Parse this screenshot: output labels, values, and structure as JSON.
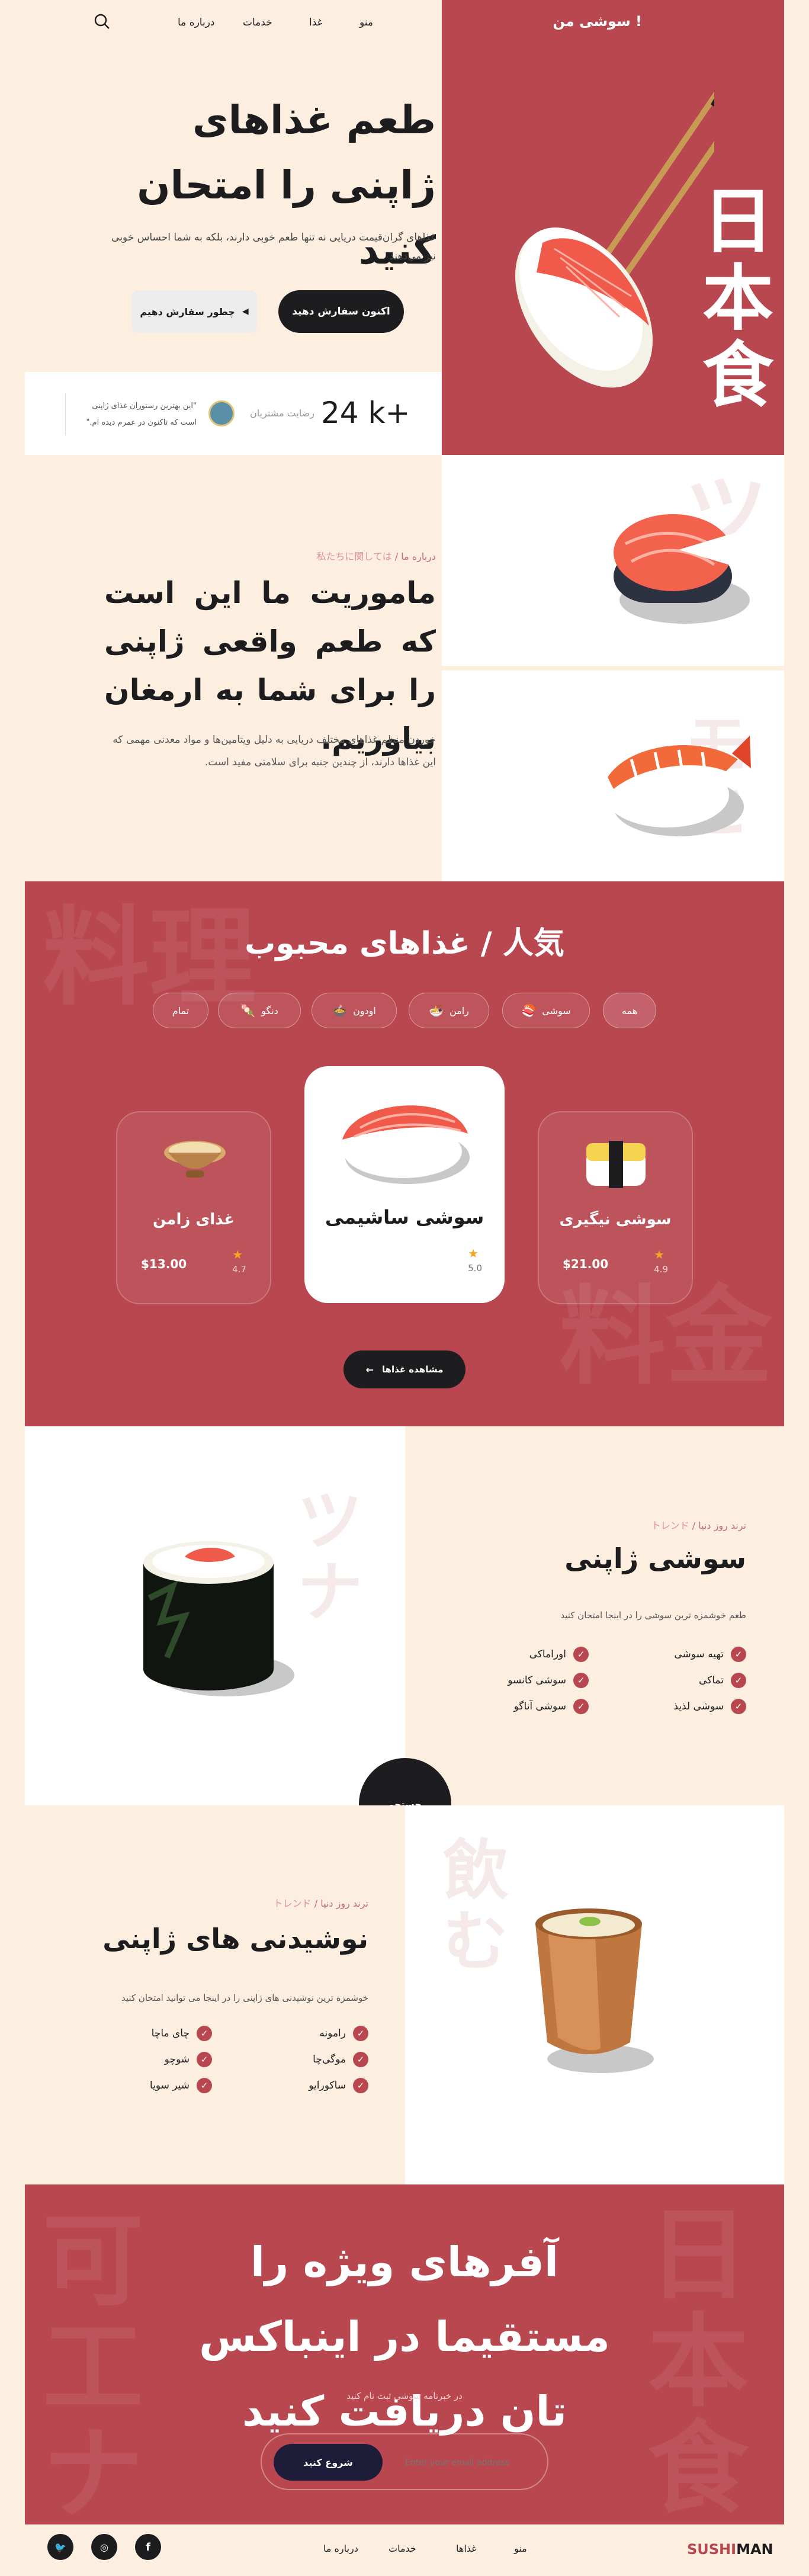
{
  "nav": {
    "menu": "منو",
    "foods": "غذا",
    "services": "خدمات",
    "about": "درباره ما",
    "brand": "سوشی من !"
  },
  "hero": {
    "title": "طعم غذاهای ژاپنی را امتحان کنید",
    "subtitle": "غذاهای گران‌قیمت دریایی نه تنها طعم خوبی دارند، بلکه به شما احساس خوبی نیز می‌دهند",
    "order_label": "اکنون سفارش دهید",
    "how_label": "چطور سفارش دهیم",
    "kanji": "日本食"
  },
  "stats": {
    "count": "24 k+",
    "label": "رضایت مشتریان",
    "quote": "\"این بهترین رستوران غذای ژاپنی است که تاکنون در عمرم دیده ام.\""
  },
  "mission": {
    "crumb_fa": "درباره ما /",
    "crumb_jp": "私たちに関しては",
    "title": "ماموریت ما این است که طعم واقعی ژاپنی را برای شما به ارمغان بیاوریم.",
    "text": "خوردن منظم غذاهای مختلف دریایی به دلیل ویتامین‌ها و مواد معدنی مهمی که این غذاها دارند، از چندین جنبه برای سلامتی مفید است.",
    "kanji1": "ツ",
    "kanji2": "モヒ"
  },
  "popular": {
    "title": "غذاهای محبوب / 人気",
    "chips": {
      "all": "همه",
      "sushi": "سوشی",
      "ramen": "رامن",
      "udon": "اودون",
      "dango": "دنگو",
      "done": "تمام"
    },
    "cards": {
      "left": {
        "name": "غذای زامن",
        "price": "$13.00",
        "rating": "4.7"
      },
      "center": {
        "name": "سوشی ساشیمی",
        "rating": "5.0"
      },
      "right": {
        "name": "سوشی نیگیری",
        "price": "$21.00",
        "rating": "4.9"
      }
    },
    "see_all": "مشاهده غذاها",
    "kanji1": "料理",
    "kanji2": "料金"
  },
  "trend_sushi": {
    "crumb_fa": "ترند روز دنیا /",
    "crumb_jp": "トレンド",
    "title": "سوشی ژاپنی",
    "subtitle": "طعم خوشمزه ترین سوشی را در اینجا امتحان کنید",
    "items": [
      "تهیه سوشی",
      "تماکی",
      "سوشی لذیذ",
      "اوراماکی",
      "سوشی کانسو",
      "سوشی آناگو"
    ],
    "kanji": "ツナ"
  },
  "search_label": "جستجو",
  "trend_drinks": {
    "crumb_fa": "ترند روز دنیا /",
    "crumb_jp": "トレンド",
    "title": "نوشیدنی های ژاپنی",
    "subtitle": "خوشمزه ترین نوشیدنی های ژاپنی را در اینجا می توانید امتحان کنید",
    "items": [
      "رامونه",
      "موگی‌چا",
      "ساکورایو",
      "چای ماچا",
      "شوچو",
      "شیر سویا"
    ],
    "kanji": "飲む"
  },
  "offers": {
    "title": "آفرهای ویژه را مستقیما در اینباکس تان دریافت کنید",
    "subtitle": "در خبرنامه سوشی ثبت نام کنید",
    "placeholder": "Enter your email address",
    "button": "شروع کنید"
  },
  "footer": {
    "brand_a": "SUSHI",
    "brand_b": "MAN",
    "menu": "منو",
    "foods": "غذاها",
    "services": "خدمات",
    "about": "درباره ما"
  },
  "colors": {
    "accent": "#b94750",
    "cream": "#fdefe0",
    "dark": "#1d1d1f",
    "star": "#f5a623"
  }
}
